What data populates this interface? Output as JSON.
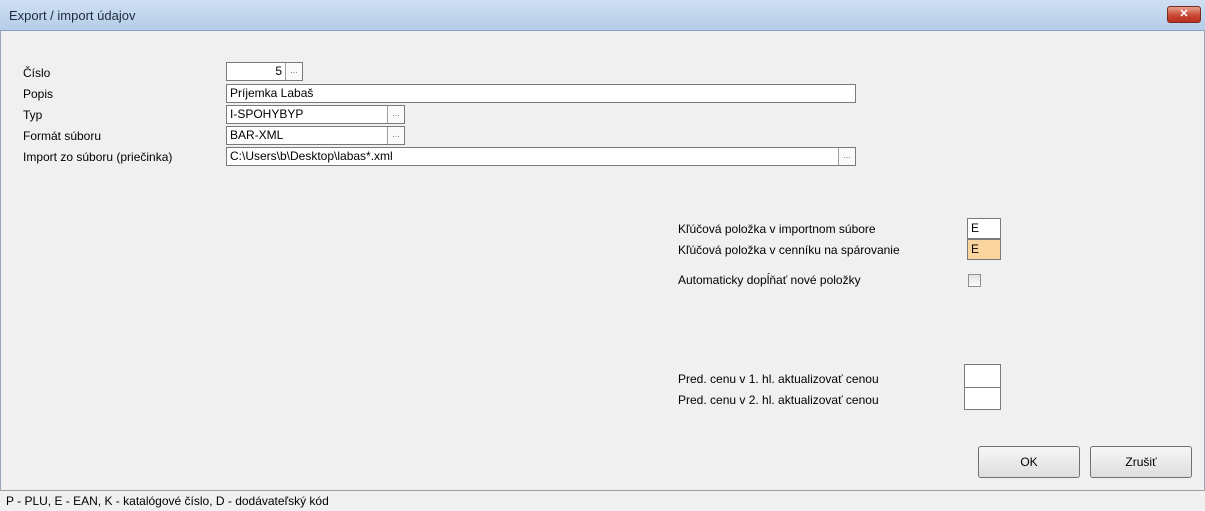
{
  "window": {
    "title": "Export / import údajov",
    "close_label": "✕"
  },
  "form": {
    "cislo_label": "Číslo",
    "cislo_value": "5",
    "popis_label": "Popis",
    "popis_value": "Príjemka Labaš",
    "typ_label": "Typ",
    "typ_value": "I-SPOHYBYP",
    "format_label": "Formát súboru",
    "format_value": "BAR-XML",
    "import_label": "Import zo súboru (priečinka)",
    "import_value": "C:\\Users\\b\\Desktop\\labas*.xml",
    "ellipsis": "..."
  },
  "options": {
    "key_import_label": "Kľúčová položka v importnom súbore",
    "key_import_value": "E",
    "key_price_label": "Kľúčová položka v cenníku na spárovanie",
    "key_price_value": "E",
    "auto_fill_label": "Automaticky dopĺňať nové položky",
    "auto_fill_checked": false,
    "price1_label": "Pred. cenu v 1. hl. aktualizovať cenou",
    "price2_label": "Pred. cenu v 2. hl. aktualizovať cenou"
  },
  "buttons": {
    "ok_label": "OK",
    "cancel_label": "Zrušiť"
  },
  "status": {
    "text": "P - PLU, E - EAN, K - katalógové číslo, D - dodávateľský kód"
  },
  "colors": {
    "highlight": "#fbd59e",
    "titlebar": "#b5cde8"
  }
}
